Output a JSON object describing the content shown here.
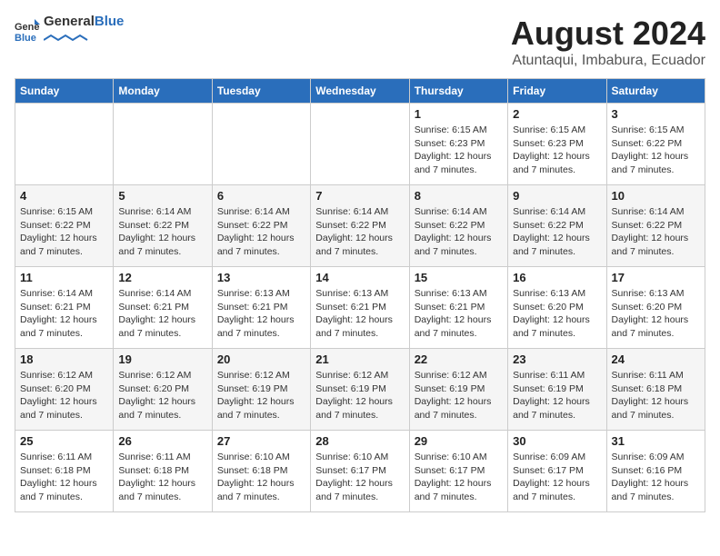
{
  "logo": {
    "text_general": "General",
    "text_blue": "Blue"
  },
  "title": {
    "month_year": "August 2024",
    "location": "Atuntaqui, Imbabura, Ecuador"
  },
  "weekdays": [
    "Sunday",
    "Monday",
    "Tuesday",
    "Wednesday",
    "Thursday",
    "Friday",
    "Saturday"
  ],
  "weeks": [
    [
      {
        "day": "",
        "sunrise": "",
        "sunset": "",
        "daylight": ""
      },
      {
        "day": "",
        "sunrise": "",
        "sunset": "",
        "daylight": ""
      },
      {
        "day": "",
        "sunrise": "",
        "sunset": "",
        "daylight": ""
      },
      {
        "day": "",
        "sunrise": "",
        "sunset": "",
        "daylight": ""
      },
      {
        "day": "1",
        "sunrise": "6:15 AM",
        "sunset": "6:23 PM",
        "daylight": "12 hours and 7 minutes."
      },
      {
        "day": "2",
        "sunrise": "6:15 AM",
        "sunset": "6:23 PM",
        "daylight": "12 hours and 7 minutes."
      },
      {
        "day": "3",
        "sunrise": "6:15 AM",
        "sunset": "6:22 PM",
        "daylight": "12 hours and 7 minutes."
      }
    ],
    [
      {
        "day": "4",
        "sunrise": "6:15 AM",
        "sunset": "6:22 PM",
        "daylight": "12 hours and 7 minutes."
      },
      {
        "day": "5",
        "sunrise": "6:14 AM",
        "sunset": "6:22 PM",
        "daylight": "12 hours and 7 minutes."
      },
      {
        "day": "6",
        "sunrise": "6:14 AM",
        "sunset": "6:22 PM",
        "daylight": "12 hours and 7 minutes."
      },
      {
        "day": "7",
        "sunrise": "6:14 AM",
        "sunset": "6:22 PM",
        "daylight": "12 hours and 7 minutes."
      },
      {
        "day": "8",
        "sunrise": "6:14 AM",
        "sunset": "6:22 PM",
        "daylight": "12 hours and 7 minutes."
      },
      {
        "day": "9",
        "sunrise": "6:14 AM",
        "sunset": "6:22 PM",
        "daylight": "12 hours and 7 minutes."
      },
      {
        "day": "10",
        "sunrise": "6:14 AM",
        "sunset": "6:22 PM",
        "daylight": "12 hours and 7 minutes."
      }
    ],
    [
      {
        "day": "11",
        "sunrise": "6:14 AM",
        "sunset": "6:21 PM",
        "daylight": "12 hours and 7 minutes."
      },
      {
        "day": "12",
        "sunrise": "6:14 AM",
        "sunset": "6:21 PM",
        "daylight": "12 hours and 7 minutes."
      },
      {
        "day": "13",
        "sunrise": "6:13 AM",
        "sunset": "6:21 PM",
        "daylight": "12 hours and 7 minutes."
      },
      {
        "day": "14",
        "sunrise": "6:13 AM",
        "sunset": "6:21 PM",
        "daylight": "12 hours and 7 minutes."
      },
      {
        "day": "15",
        "sunrise": "6:13 AM",
        "sunset": "6:21 PM",
        "daylight": "12 hours and 7 minutes."
      },
      {
        "day": "16",
        "sunrise": "6:13 AM",
        "sunset": "6:20 PM",
        "daylight": "12 hours and 7 minutes."
      },
      {
        "day": "17",
        "sunrise": "6:13 AM",
        "sunset": "6:20 PM",
        "daylight": "12 hours and 7 minutes."
      }
    ],
    [
      {
        "day": "18",
        "sunrise": "6:12 AM",
        "sunset": "6:20 PM",
        "daylight": "12 hours and 7 minutes."
      },
      {
        "day": "19",
        "sunrise": "6:12 AM",
        "sunset": "6:20 PM",
        "daylight": "12 hours and 7 minutes."
      },
      {
        "day": "20",
        "sunrise": "6:12 AM",
        "sunset": "6:19 PM",
        "daylight": "12 hours and 7 minutes."
      },
      {
        "day": "21",
        "sunrise": "6:12 AM",
        "sunset": "6:19 PM",
        "daylight": "12 hours and 7 minutes."
      },
      {
        "day": "22",
        "sunrise": "6:12 AM",
        "sunset": "6:19 PM",
        "daylight": "12 hours and 7 minutes."
      },
      {
        "day": "23",
        "sunrise": "6:11 AM",
        "sunset": "6:19 PM",
        "daylight": "12 hours and 7 minutes."
      },
      {
        "day": "24",
        "sunrise": "6:11 AM",
        "sunset": "6:18 PM",
        "daylight": "12 hours and 7 minutes."
      }
    ],
    [
      {
        "day": "25",
        "sunrise": "6:11 AM",
        "sunset": "6:18 PM",
        "daylight": "12 hours and 7 minutes."
      },
      {
        "day": "26",
        "sunrise": "6:11 AM",
        "sunset": "6:18 PM",
        "daylight": "12 hours and 7 minutes."
      },
      {
        "day": "27",
        "sunrise": "6:10 AM",
        "sunset": "6:18 PM",
        "daylight": "12 hours and 7 minutes."
      },
      {
        "day": "28",
        "sunrise": "6:10 AM",
        "sunset": "6:17 PM",
        "daylight": "12 hours and 7 minutes."
      },
      {
        "day": "29",
        "sunrise": "6:10 AM",
        "sunset": "6:17 PM",
        "daylight": "12 hours and 7 minutes."
      },
      {
        "day": "30",
        "sunrise": "6:09 AM",
        "sunset": "6:17 PM",
        "daylight": "12 hours and 7 minutes."
      },
      {
        "day": "31",
        "sunrise": "6:09 AM",
        "sunset": "6:16 PM",
        "daylight": "12 hours and 7 minutes."
      }
    ]
  ]
}
